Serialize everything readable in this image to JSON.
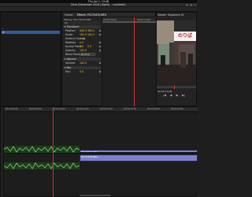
{
  "topbar": {
    "clock": "Thu Jan 1, 13:48"
  },
  "window": {
    "title": "Olive (December 2016 | Alpha) - <untitled>"
  },
  "project": {
    "rows": [
      {
        "label": "...",
        "selected": false
      },
      {
        "label": ".4",
        "selected": true
      },
      {
        "label": "",
        "selected": false
      }
    ]
  },
  "effects": {
    "tabs": [
      "Viewer",
      "Effects: P1170470.MP4"
    ],
    "clip_path": "Effects: P1170470.MP4",
    "sub_label": "V1",
    "sections": {
      "transform": "Transform",
      "volume": "Volume",
      "pan": "Pan"
    },
    "transform_rows": [
      {
        "label": "Position:",
        "v1": "640.0",
        "v2": "360.0"
      },
      {
        "label": "Scale:",
        "v1": "100.0",
        "v2": "100.0"
      },
      {
        "label": "Uniform Scale:",
        "v1": "",
        "v2": ""
      },
      {
        "label": "Rotation:",
        "v1": "0.0",
        "v2": ""
      },
      {
        "label": "Anchor Point:",
        "v1": "0.0",
        "v2": "0.0"
      },
      {
        "label": "Opacity:",
        "v1": "100.0",
        "v2": ""
      },
      {
        "label": "Blend Mode:",
        "v1": "Normal",
        "v2": ""
      }
    ],
    "volume_row": {
      "label": "Volume:",
      "v1": "100.0"
    },
    "pan_row": {
      "label": "Pan:",
      "v1": "0.0"
    },
    "kf_times": [
      "00:00:00:00",
      "00:00:10:00"
    ]
  },
  "viewer": {
    "label": "Viewer: Sequence 01",
    "sign_text": "のりば",
    "time": "00:00:10:09",
    "controls": [
      "|◀",
      "◀",
      "▶",
      "▶|"
    ]
  },
  "timeline": {
    "ticks": [
      "00:00:00:00",
      "00:00:05:00",
      "00:00:10:00",
      "00:00:12:00",
      "00:00:15:00",
      "00:00:17:00",
      "00:00:20:00",
      "00:00:22:00"
    ],
    "video_clip_label": "P1170470.MP4",
    "audio_clip_label": "P1170470.MP4"
  },
  "colors": {
    "accent": "#f0c419",
    "playhead": "#d43030",
    "clip": "#7f7fcf",
    "selection": "#2f5d9e"
  }
}
